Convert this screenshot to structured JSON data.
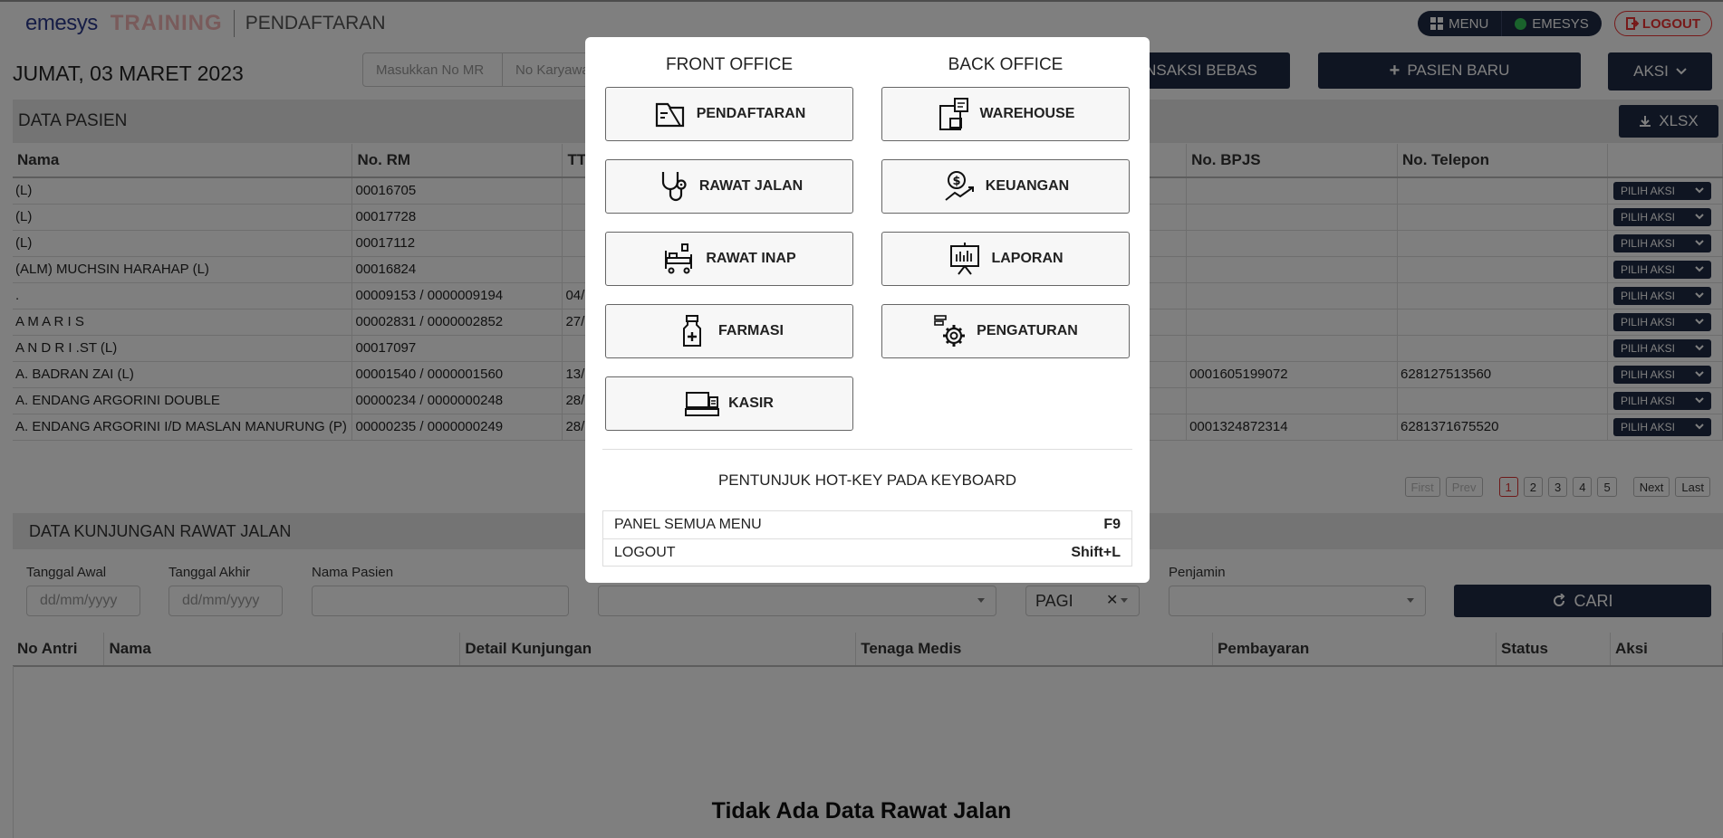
{
  "topbar": {
    "logo": "emesys",
    "env_label": "TRAINING",
    "module": "PENDAFTARAN",
    "menu_label": "MENU",
    "user_label": "EMESYS",
    "logout_label": "LOGOUT",
    "status_color": "#34c759",
    "logout_color": "#e33333"
  },
  "header": {
    "date": "JUMAT, 03 MARET 2023",
    "mr_placeholder": "Masukkan No MR",
    "karyawan_placeholder": "No Karyawan",
    "transaksi_bebas_label": "TRANSAKSI BEBAS",
    "pasien_baru_label": "PASIEN BARU",
    "aksi_label": "AKSI"
  },
  "data_pasien": {
    "title": "DATA PASIEN",
    "export_label": "XLSX",
    "columns": [
      "Nama",
      "No. RM",
      "TTL",
      "No. BPJS",
      "No. Telepon"
    ],
    "row_action": "PILIH AKSI",
    "rows": [
      {
        "nama": "(L)",
        "rm": "00016705",
        "ttl": "",
        "bpjs": "",
        "telp": ""
      },
      {
        "nama": "(L)",
        "rm": "00017728",
        "ttl": "",
        "bpjs": "",
        "telp": ""
      },
      {
        "nama": "(L)",
        "rm": "00017112",
        "ttl": "",
        "bpjs": "",
        "telp": ""
      },
      {
        "nama": "(ALM) MUCHSIN HARAHAP (L)",
        "rm": "00016824",
        "ttl": "",
        "bpjs": "",
        "telp": ""
      },
      {
        "nama": ".",
        "rm": "00009153 / 0000009194",
        "ttl": "04/",
        "bpjs": "",
        "telp": ""
      },
      {
        "nama": "A M A R I S",
        "rm": "00002831 / 0000002852",
        "ttl": "27/",
        "bpjs": "",
        "telp": ""
      },
      {
        "nama": "A N D R I .ST (L)",
        "rm": "00017097",
        "ttl": "",
        "bpjs": "",
        "telp": ""
      },
      {
        "nama": "A. BADRAN ZAI (L)",
        "rm": "00001540 / 0000001560",
        "ttl": "13/",
        "bpjs": "0001605199072",
        "telp": "628127513560"
      },
      {
        "nama": "A. ENDANG ARGORINI DOUBLE",
        "rm": "00000234 / 0000000248",
        "ttl": "28/",
        "bpjs": "",
        "telp": ""
      },
      {
        "nama": "A. ENDANG ARGORINI I/D MASLAN MANURUNG (P)",
        "rm": "00000235 / 0000000249",
        "ttl": "28/",
        "bpjs": "0001324872314",
        "telp": "6281371675520"
      }
    ],
    "pager": {
      "first": "First",
      "prev": "Prev",
      "pages": [
        "1",
        "2",
        "3",
        "4",
        "5"
      ],
      "current": "1",
      "next": "Next",
      "last": "Last"
    }
  },
  "kunjungan": {
    "title": "DATA KUNJUNGAN RAWAT JALAN",
    "tanggal_awal_label": "Tanggal Awal",
    "tanggal_akhir_label": "Tanggal Akhir",
    "nama_pasien_label": "Nama Pasien",
    "penjamin_label": "Penjamin",
    "date_placeholder": "dd/mm/yyyy",
    "shift_value": "PAGI",
    "cari_label": "CARI",
    "columns": [
      "No Antri",
      "Nama",
      "Detail Kunjungan",
      "Tenaga Medis",
      "Pembayaran",
      "Status",
      "Aksi"
    ],
    "empty_message": "Tidak Ada Data Rawat Jalan"
  },
  "modal": {
    "front_office_title": "FRONT OFFICE",
    "back_office_title": "BACK OFFICE",
    "front_items": [
      {
        "label": "PENDAFTARAN",
        "icon": "registration-icon"
      },
      {
        "label": "RAWAT JALAN",
        "icon": "stethoscope-icon"
      },
      {
        "label": "RAWAT INAP",
        "icon": "hospital-bed-icon"
      },
      {
        "label": "FARMASI",
        "icon": "medicine-bottle-icon"
      },
      {
        "label": "KASIR",
        "icon": "cash-register-icon"
      }
    ],
    "back_items": [
      {
        "label": "WAREHOUSE",
        "icon": "warehouse-icon"
      },
      {
        "label": "KEUANGAN",
        "icon": "finance-icon"
      },
      {
        "label": "LAPORAN",
        "icon": "report-board-icon"
      },
      {
        "label": "PENGATURAN",
        "icon": "settings-gear-icon"
      }
    ],
    "hotkey_title": "PENTUNJUK HOT-KEY PADA KEYBOARD",
    "hotkeys": [
      {
        "action": "PANEL SEMUA MENU",
        "key": "F9"
      },
      {
        "action": "LOGOUT",
        "key": "Shift+L"
      }
    ]
  }
}
